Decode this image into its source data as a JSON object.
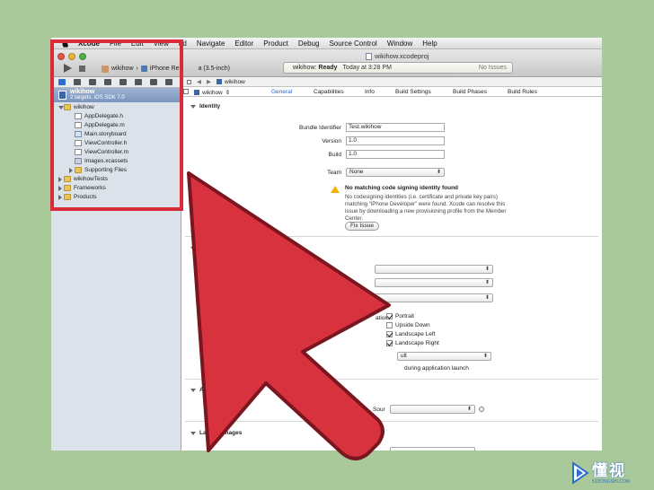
{
  "menubar": {
    "items": [
      "Xcode",
      "File",
      "Edit",
      "View",
      "nd",
      "Navigate",
      "Editor",
      "Product",
      "Debug",
      "Source Control",
      "Window",
      "Help"
    ]
  },
  "toolbar": {
    "window_title": "wikihow.xcodeproj",
    "scheme": "wikihow",
    "scheme_sep": "›",
    "device": "iPhone Re",
    "device_tail": "a (3.5-inch)",
    "status_project": "wikihow:",
    "status_state": "Ready",
    "status_time": "Today at 3:28 PM",
    "status_issues": "No Issues"
  },
  "navigator": {
    "project_name": "wikihow",
    "project_sub": "2 targets, iOS SDK 7.0",
    "tree": [
      {
        "label": "wikihow",
        "kind": "folder",
        "depth": 1,
        "open": true
      },
      {
        "label": "AppDelegate.h",
        "kind": "hfile",
        "depth": 2
      },
      {
        "label": "AppDelegate.m",
        "kind": "mfile",
        "depth": 2
      },
      {
        "label": "Main.storyboard",
        "kind": "sb",
        "depth": 2
      },
      {
        "label": "ViewController.h",
        "kind": "hfile",
        "depth": 2
      },
      {
        "label": "ViewController.m",
        "kind": "mfile",
        "depth": 2
      },
      {
        "label": "Images.xcassets",
        "kind": "assets",
        "depth": 2
      },
      {
        "label": "Supporting Files",
        "kind": "folder",
        "depth": 2,
        "open": false
      },
      {
        "label": "wikihowTests",
        "kind": "folder",
        "depth": 1,
        "open": false
      },
      {
        "label": "Frameworks",
        "kind": "folder",
        "depth": 1,
        "open": false
      },
      {
        "label": "Products",
        "kind": "folder",
        "depth": 1,
        "open": false
      }
    ]
  },
  "editor": {
    "jump_project": "wikihow",
    "target_name": "wikihow",
    "target_caret": "⇕",
    "tabs": [
      "General",
      "Capabilities",
      "Info",
      "Build Settings",
      "Build Phases",
      "Build Rules"
    ],
    "identity": {
      "header": "Identity",
      "bundle_label": "Bundle Identifier",
      "bundle_value": "Test.wikihow",
      "version_label": "Version",
      "version_value": "1.0",
      "build_label": "Build",
      "build_value": "1.0",
      "team_label": "Team",
      "team_value": "None",
      "warning_title": "No matching code signing identity found",
      "warning_body": "No codesigning identities (i.e. certificate and private key pairs) matching “iPhone Developer” were found.  Xcode can resolve this issue by downloading a new provisioning profile from the Member Center.",
      "fix_button": "Fix Issue"
    },
    "deployment": {
      "header_fragment": "D",
      "orientation_fragment": "ation",
      "orientations": [
        {
          "label": "Portrait",
          "checked": true
        },
        {
          "label": "Upside Down",
          "checked": false
        },
        {
          "label": "Landscape Left",
          "checked": true
        },
        {
          "label": "Landscape Right",
          "checked": true
        }
      ],
      "status_bar_fragment": "ult",
      "launch_fragment": "during application launch"
    },
    "app_icons": {
      "header": "App Icons",
      "source_fragment": "Sour"
    },
    "launch_images": {
      "header": "Launch Images"
    }
  },
  "colors": {
    "background": "#a9c99a",
    "highlight_box": "#db2a3a",
    "arrow_fill": "#d8323e",
    "accent": "#2c63c8"
  },
  "watermark": {
    "text": "懂视",
    "sub": "51DONGSHI.COM"
  }
}
